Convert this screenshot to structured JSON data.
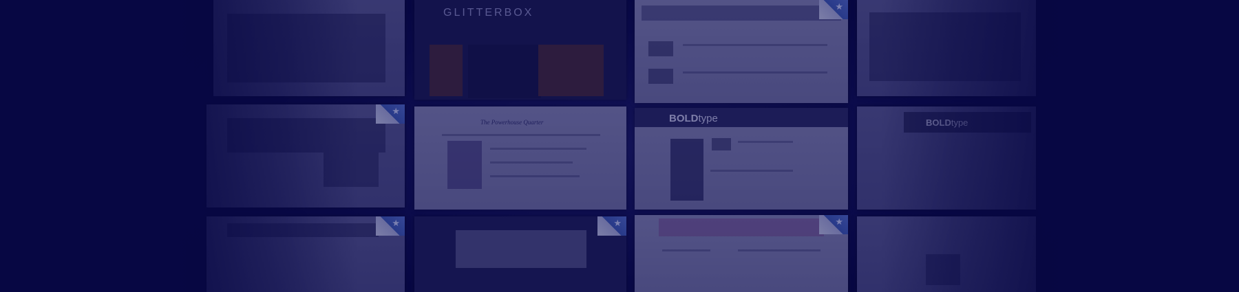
{
  "tiles": {
    "glitterbox": {
      "logo": "GLITTERBOX"
    },
    "bold_center": {
      "logo_bold": "BOLD",
      "logo_light": "type"
    },
    "bold_right": {
      "logo_bold": "BOLD",
      "logo_light": "type"
    },
    "paper": {
      "title": "The Powerhouse Quarter"
    }
  },
  "colors": {
    "background": "#05053a",
    "accent": "#4060b8"
  },
  "icons": [
    "page-curl-star-icon"
  ]
}
